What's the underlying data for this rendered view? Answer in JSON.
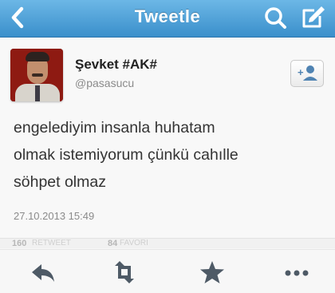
{
  "header": {
    "title": "Tweetle",
    "bar_color_top": "#6cb7e6",
    "bar_color_bottom": "#3a8fcb",
    "icons": {
      "back": "chevron-left-icon",
      "search": "search-icon",
      "compose": "compose-icon"
    }
  },
  "tweet": {
    "author_name": "Şevket #AK#",
    "author_handle": "@pasasucu",
    "text": "engelediyim insanla huhatam\nolmak istemiyorum çünkü cahılle\nsöhpet olmaz",
    "timestamp": "27.10.2013 15:49",
    "follow_icon": "add-user-icon"
  },
  "stats": {
    "retweets": "160",
    "retweets_label": "RETWEET",
    "favorites": "84",
    "favorites_label": "FAVORİ"
  },
  "actions": {
    "icons": [
      "reply-icon",
      "retweet-icon",
      "star-icon",
      "more-icon"
    ],
    "icon_color": "#4e5a66"
  }
}
